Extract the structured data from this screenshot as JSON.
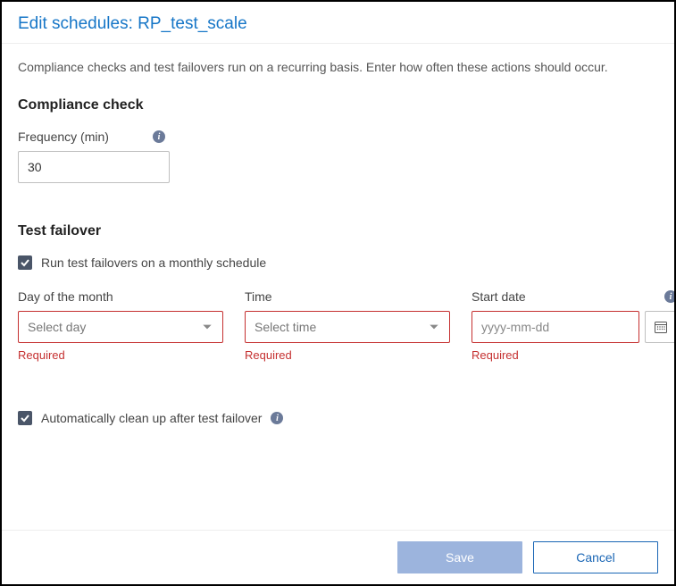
{
  "header": {
    "title": "Edit schedules: RP_test_scale"
  },
  "description": "Compliance checks and test failovers run on a recurring basis. Enter how often these actions should occur.",
  "compliance": {
    "heading": "Compliance check",
    "frequency_label": "Frequency (min)",
    "frequency_value": "30"
  },
  "failover": {
    "heading": "Test failover",
    "run_monthly_label": "Run test failovers on a monthly schedule",
    "run_monthly_checked": true,
    "day": {
      "label": "Day of the month",
      "placeholder": "Select day",
      "value": "",
      "error": "Required"
    },
    "time": {
      "label": "Time",
      "placeholder": "Select time",
      "value": "",
      "error": "Required"
    },
    "start_date": {
      "label": "Start date",
      "placeholder": "yyyy-mm-dd",
      "value": "",
      "error": "Required"
    },
    "cleanup_label": "Automatically clean up after test failover",
    "cleanup_checked": true
  },
  "footer": {
    "save": "Save",
    "cancel": "Cancel"
  },
  "info_glyph": "i"
}
